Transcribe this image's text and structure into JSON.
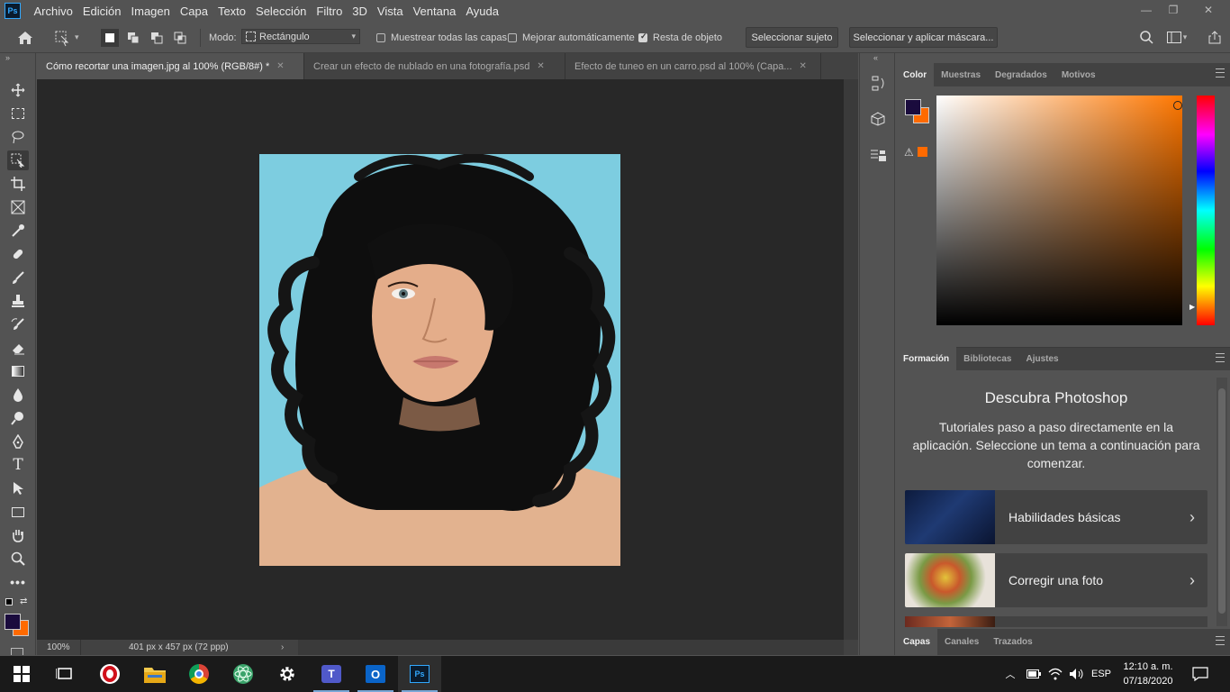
{
  "app": {
    "logo": "Ps",
    "menu": [
      "Archivo",
      "Edición",
      "Imagen",
      "Capa",
      "Texto",
      "Selección",
      "Filtro",
      "3D",
      "Vista",
      "Ventana",
      "Ayuda"
    ]
  },
  "options_bar": {
    "mode_label": "Modo:",
    "mode_value": "Rectángulo",
    "sample_all_layers": {
      "label": "Muestrear todas las capas",
      "checked": false
    },
    "auto_enhance": {
      "label": "Mejorar automáticamente",
      "checked": false
    },
    "object_subtract": {
      "label": "Resta de objeto",
      "checked": true
    },
    "select_subject_button": "Seleccionar sujeto",
    "select_and_mask_button": "Seleccionar y aplicar máscara..."
  },
  "tabs": [
    {
      "label": "Cómo recortar una imagen.jpg al 100% (RGB/8#) *",
      "active": true
    },
    {
      "label": "Crear un efecto de nublado en una fotografía.psd",
      "active": false
    },
    {
      "label": "Efecto de tuneo en un carro.psd al 100% (Capa...",
      "active": false
    }
  ],
  "status": {
    "zoom": "100%",
    "doc_info": "401 px x 457 px (72 ppp)"
  },
  "colors": {
    "foreground": "#1a0b3d",
    "background": "#ff6a00",
    "canvas_bg": "#7dcde0"
  },
  "color_panel": {
    "tabs": [
      "Color",
      "Muestras",
      "Degradados",
      "Motivos"
    ]
  },
  "learn_panel": {
    "tabs": [
      "Formación",
      "Bibliotecas",
      "Ajustes"
    ],
    "heading": "Descubra Photoshop",
    "description": "Tutoriales paso a paso directamente en la aplicación. Seleccione un tema a continuación para comenzar.",
    "cards": [
      {
        "label": "Habilidades básicas"
      },
      {
        "label": "Corregir una foto"
      }
    ]
  },
  "layers_panel": {
    "tabs": [
      "Capas",
      "Canales",
      "Trazados"
    ]
  },
  "taskbar": {
    "language": "ESP",
    "time": "12:10 a. m.",
    "date": "07/18/2020"
  }
}
